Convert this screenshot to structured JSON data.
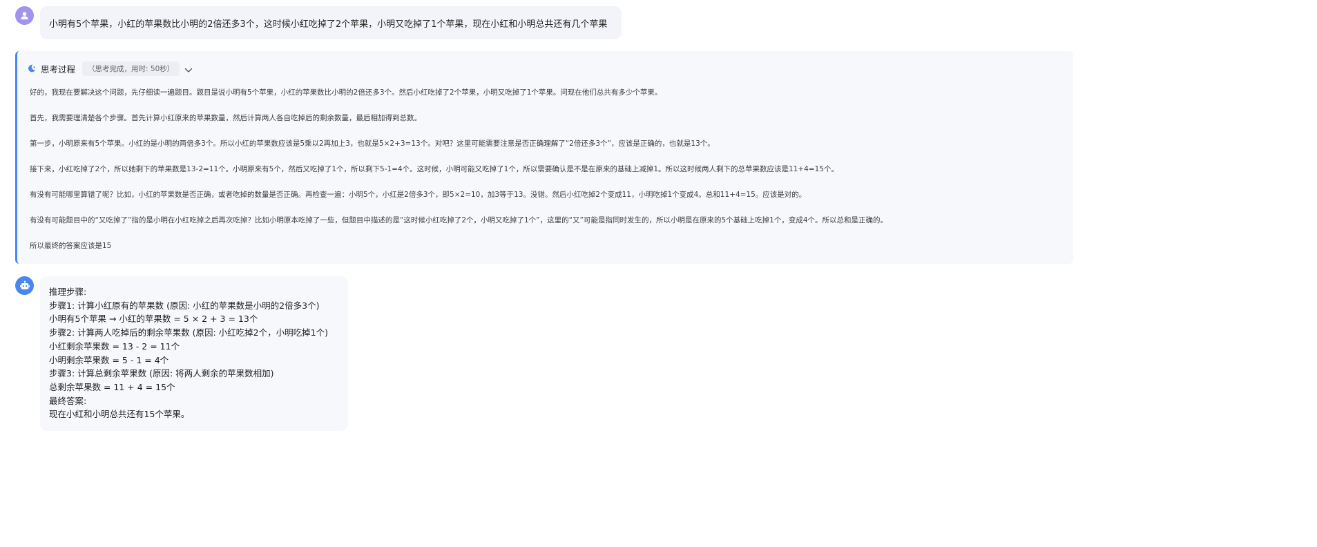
{
  "user_message": {
    "avatar_icon": "user-icon",
    "text": "小明有5个苹果，小红的苹果数比小明的2倍还多3个，这时候小红吃掉了2个苹果，小明又吃掉了1个苹果，现在小红和小明总共还有几个苹果"
  },
  "thinking": {
    "icon": "thinking-icon",
    "title": "思考过程",
    "status": "（思考完成，用时: 50秒）",
    "paragraphs": [
      "好的，我现在要解决这个问题，先仔细读一遍题目。题目是说小明有5个苹果，小红的苹果数比小明的2倍还多3个。然后小红吃掉了2个苹果，小明又吃掉了1个苹果。问现在他们总共有多少个苹果。",
      "首先，我需要理清楚各个步骤。首先计算小红原来的苹果数量，然后计算两人各自吃掉后的剩余数量，最后相加得到总数。",
      "第一步，小明原来有5个苹果。小红的是小明的两倍多3个。所以小红的苹果数应该是5乘以2再加上3，也就是5×2+3=13个。对吧？这里可能需要注意是否正确理解了“2倍还多3个”，应该是正确的，也就是13个。",
      "接下来，小红吃掉了2个，所以她剩下的苹果数是13-2=11个。小明原来有5个，然后又吃掉了1个，所以剩下5-1=4个。这时候，小明可能又吃掉了1个，所以需要确认是不是在原来的基础上减掉1。所以这时候两人剩下的总苹果数应该是11+4=15个。",
      "有没有可能哪里算错了呢？比如，小红的苹果数是否正确，或者吃掉的数量是否正确。再检查一遍：小明5个，小红是2倍多3个，即5×2=10，加3等于13。没错。然后小红吃掉2个变成11，小明吃掉1个变成4。总和11+4=15。应该是对的。",
      "有没有可能题目中的“又吃掉了”指的是小明在小红吃掉之后再次吃掉？比如小明原本吃掉了一些，但题目中描述的是“这时候小红吃掉了2个，小明又吃掉了1个”，这里的“又”可能是指同时发生的，所以小明是在原来的5个基础上吃掉1个，变成4个。所以总和是正确的。",
      "所以最终的答案应该是15"
    ]
  },
  "answer": {
    "avatar_icon": "robot-icon",
    "lines": [
      "推理步骤:",
      "步骤1: 计算小红原有的苹果数 (原因: 小红的苹果数是小明的2倍多3个)",
      "小明有5个苹果 → 小红的苹果数 = 5 × 2 + 3 = 13个",
      "步骤2: 计算两人吃掉后的剩余苹果数 (原因: 小红吃掉2个，小明吃掉1个)",
      "小红剩余苹果数 = 13 - 2 = 11个",
      "小明剩余苹果数 = 5 - 1 = 4个",
      "步骤3: 计算总剩余苹果数 (原因: 将两人剩余的苹果数相加)",
      "总剩余苹果数 = 11 + 4 = 15个",
      "最终答案:",
      "现在小红和小明总共还有15个苹果。"
    ]
  },
  "colors": {
    "accent": "#4a86f0",
    "user_avatar": "#a294ee",
    "bubble_bg": "#f2f4f9",
    "panel_bg": "#f7f8fb"
  }
}
